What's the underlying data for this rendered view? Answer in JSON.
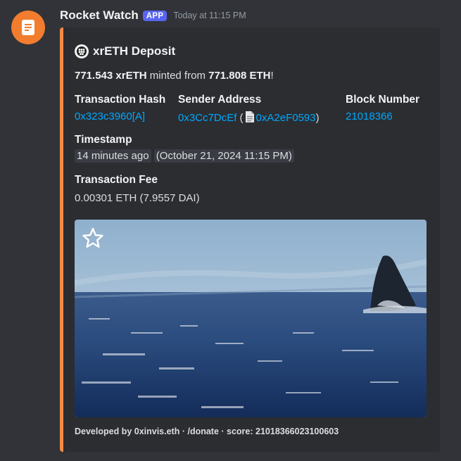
{
  "message": {
    "username": "Rocket Watch",
    "badge": "APP",
    "timestamp": "Today at 11:15 PM"
  },
  "embed": {
    "title": "xrETH Deposit",
    "accent_color": "#f28a45",
    "description": {
      "amount_minted": "771.543 xrETH",
      "middle_text": " minted from ",
      "amount_source": "771.808 ETH",
      "end_text": "!"
    },
    "fields": {
      "tx_hash": {
        "name": "Transaction Hash",
        "value": "0x323c3960[A]"
      },
      "sender": {
        "name": "Sender Address",
        "value": "0x3Cc7DcEf",
        "open_paren": " (",
        "contract": "0xA2eF0593",
        "close_paren": ")"
      },
      "block": {
        "name": "Block Number",
        "value": "21018366"
      },
      "timestamp": {
        "name": "Timestamp",
        "relative": "14 minutes ago",
        "absolute": "October 21, 2024 11:15 PM"
      },
      "fee": {
        "name": "Transaction Fee",
        "value": "0.00301 ETH (7.9557 DAI)"
      }
    },
    "footer": "Developed by 0xinvis.eth · /donate · score: 21018366023100603"
  }
}
